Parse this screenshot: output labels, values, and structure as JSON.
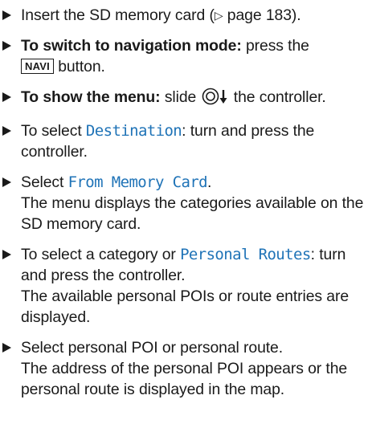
{
  "steps": [
    {
      "before": "Insert the SD memory card (",
      "pageref_symbol": "▷",
      "after": " page 183)."
    },
    {
      "bold": "To switch to navigation mode:",
      "before": " press the",
      "key": "NAVI",
      "after": " button."
    },
    {
      "bold": "To show the menu:",
      "before": " slide ",
      "icon": "controller-slide-down-icon",
      "after": " the controller."
    },
    {
      "before": "To select ",
      "mono": "Destination",
      "after": ": turn and press the controller."
    },
    {
      "before": "Select ",
      "mono": "From Memory Card",
      "after": ".",
      "result": "The menu displays the categories available on the SD memory card."
    },
    {
      "before": "To select a category or ",
      "mono": "Personal Routes",
      "after": ": turn and press the controller.",
      "result": "The available personal POIs or route entries are displayed."
    },
    {
      "before": "Select personal POI or personal route.",
      "result": "The address of the personal POI appears or the personal route is displayed in the map."
    }
  ],
  "colors": {
    "text": "#1a1a1a",
    "menu_item": "#1f73b7",
    "background": "#ffffff"
  }
}
